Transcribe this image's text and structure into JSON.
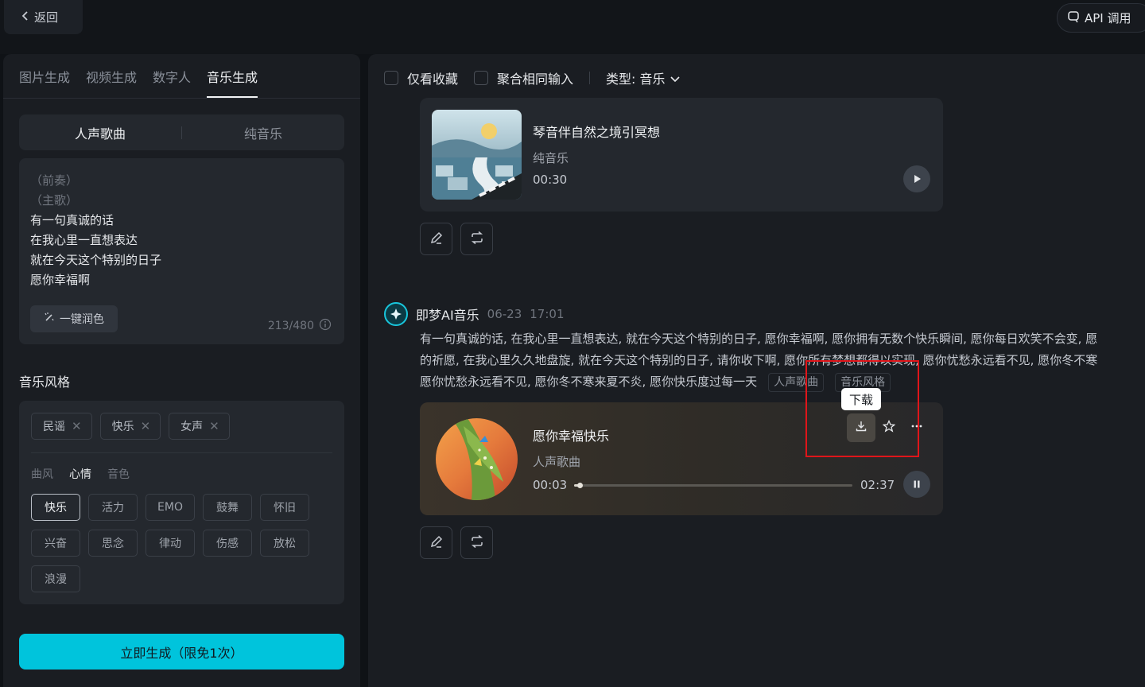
{
  "header": {
    "back_label": "返回",
    "api_label": "API 调用"
  },
  "left": {
    "tabs": [
      "图片生成",
      "视频生成",
      "数字人",
      "音乐生成"
    ],
    "mode": {
      "vocal": "人声歌曲",
      "instrumental": "纯音乐"
    },
    "lyrics": {
      "placeholders": [
        "（前奏）",
        "（主歌）"
      ],
      "lines": [
        "有一句真诚的话",
        "在我心里一直想表达",
        "就在今天这个特别的日子",
        "愿你幸福啊"
      ]
    },
    "polish_label": "一键润色",
    "counter": "213/480",
    "style_title": "音乐风格",
    "selected_tags": [
      "民谣",
      "快乐",
      "女声"
    ],
    "sub_tabs": [
      "曲风",
      "心情",
      "音色"
    ],
    "chips": [
      "快乐",
      "活力",
      "EMO",
      "鼓舞",
      "怀旧",
      "兴奋",
      "思念",
      "律动",
      "伤感",
      "放松",
      "浪漫"
    ],
    "generate_label": "立即生成（限免1次）"
  },
  "right": {
    "filters": {
      "favorites": "仅看收藏",
      "aggregate": "聚合相同输入",
      "type": "类型: 音乐"
    },
    "track1": {
      "title": "琴音伴自然之境引冥想",
      "type": "纯音乐",
      "duration": "00:30"
    },
    "bot": {
      "name": "即梦AI音乐",
      "date": "06-23",
      "time": "17:01"
    },
    "prompt_lines": [
      "有一句真诚的话, 在我心里一直想表达, 就在今天这个特别的日子, 愿你幸福啊, 愿你拥有无数个快乐瞬间, 愿你每日欢笑不会变, 愿",
      "的祈愿, 在我心里久久地盘旋, 就在今天这个特别的日子, 请你收下啊, 愿你所有梦想都得以实现, 愿你忧愁永远看不见, 愿你冬不寒",
      "愿你忧愁永远看不见, 愿你冬不寒来夏不炎, 愿你快乐度过每一天"
    ],
    "prompt_tags": [
      "人声歌曲",
      "音乐风格"
    ],
    "track2": {
      "title": "愿你幸福快乐",
      "type": "人声歌曲",
      "current": "00:03",
      "duration": "02:37",
      "progress": 0.02
    },
    "tooltip": "下载"
  }
}
